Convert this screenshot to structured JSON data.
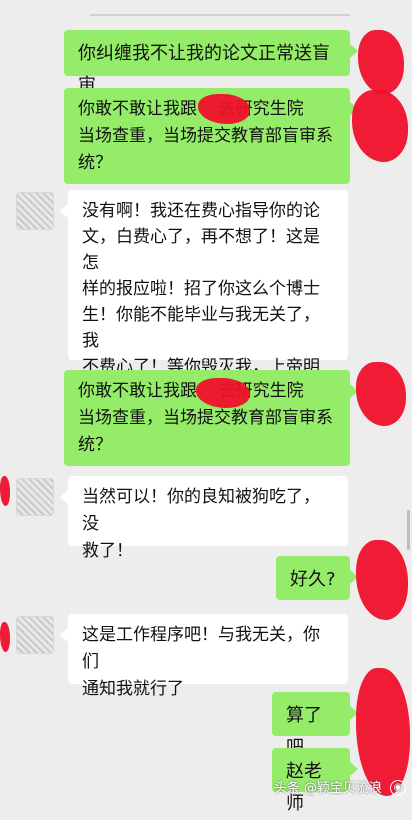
{
  "messages": [
    {
      "side": "sent",
      "text": "你纠缠我不让我的论文正常送盲审"
    },
    {
      "side": "sent",
      "text": "你敢不敢让我跟    去研究生院\n当场查重，当场提交教育部盲审系\n统？"
    },
    {
      "side": "recv",
      "text": "没有啊！我还在费心指导你的论\n文，白费心了，再不想了！这是怎\n样的报应啦！招了你这么个博士\n生！你能不能毕业与我无关了，我\n不费心了！等你毁灭我，上帝明白\n一切！"
    },
    {
      "side": "sent",
      "text": "你敢不敢让我跟    去研究生院\n当场查重，当场提交教育部盲审系\n统？"
    },
    {
      "side": "recv",
      "text": "当然可以！你的良知被狗吃了，没\n救了！"
    },
    {
      "side": "sent",
      "text": "好久?"
    },
    {
      "side": "recv",
      "text": "这是工作程序吧！与我无关，你们\n通知我就行了"
    },
    {
      "side": "sent",
      "text": "算了吧"
    },
    {
      "side": "sent",
      "text": "赵老师"
    }
  ],
  "watermark": {
    "text": "头条 @颖宝贝流浪"
  },
  "colors": {
    "sent": "#95ec69",
    "recv": "#ffffff",
    "background": "#ededed",
    "redaction": "#f0102a"
  }
}
